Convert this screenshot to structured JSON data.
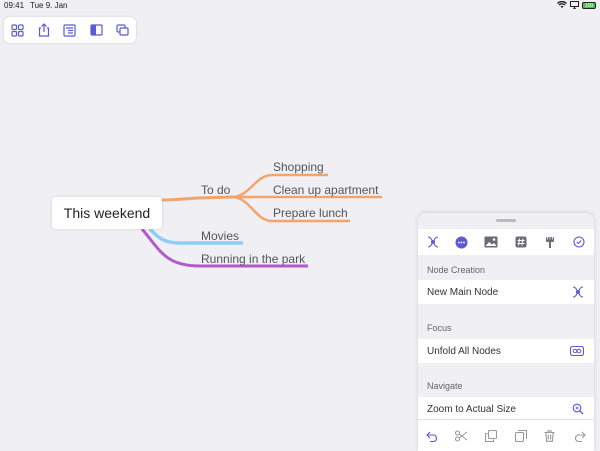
{
  "status_bar": {
    "time": "09:41",
    "date": "Tue 9. Jan",
    "battery": "100"
  },
  "toolbar": {
    "buttons": [
      {
        "name": "grid-view-icon"
      },
      {
        "name": "share-icon"
      },
      {
        "name": "outline-icon"
      },
      {
        "name": "sidebar-icon"
      },
      {
        "name": "windows-icon"
      }
    ]
  },
  "mindmap": {
    "root": "This weekend",
    "branches": [
      {
        "label": "To do",
        "color": "#f4a46b",
        "children": [
          "Shopping",
          "Clean up apartment",
          "Prepare lunch"
        ]
      },
      {
        "label": "Movies",
        "color": "#8ecdf5",
        "children": []
      },
      {
        "label": "Running in the park",
        "color": "#b15cc9",
        "children": []
      }
    ]
  },
  "panel": {
    "accent": "#5b5bd6",
    "sections": [
      {
        "title": "Node Creation",
        "row": "New Main Node",
        "icon": "new-node-icon"
      },
      {
        "title": "Focus",
        "row": "Unfold All Nodes",
        "icon": "unfold-icon"
      },
      {
        "title": "Navigate",
        "row": "Zoom to Actual Size",
        "icon": "zoom-icon"
      }
    ],
    "tabs": [
      "node-layout-icon",
      "more-icon",
      "image-icon",
      "tag-icon",
      "paint-icon",
      "checkmark-icon"
    ],
    "bottom": [
      "undo-icon",
      "cut-icon",
      "copy-icon",
      "paste-icon",
      "delete-icon",
      "redo-icon"
    ]
  }
}
